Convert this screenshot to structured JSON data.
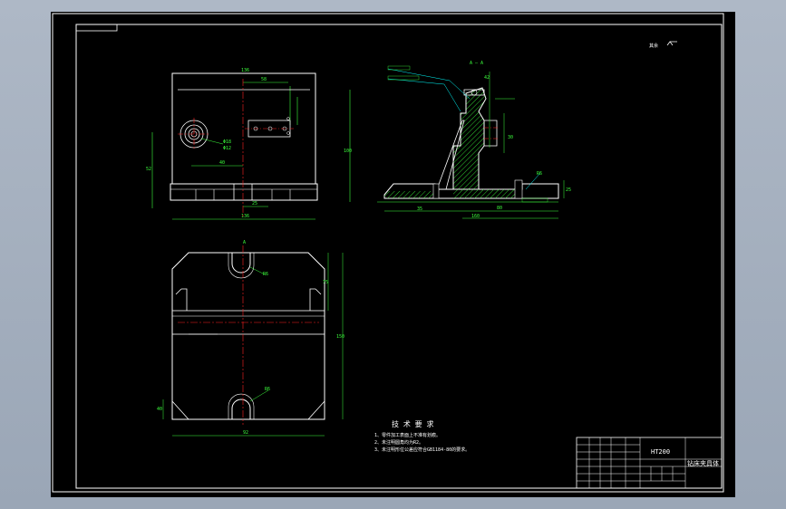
{
  "drawing": {
    "section_label": "A — A",
    "view_label": "A",
    "roughness_note": "其余",
    "tech_requirements": {
      "title": "技 术 要 求",
      "items": [
        "1、零件加工表面上不准有划痕。",
        "2、未注明圆角均为R2。",
        "3、未注明形位公差应符合GB1184-80的要求。"
      ]
    },
    "title_block": {
      "part_number": "HT200",
      "drawing_name": "钻床夹具体"
    },
    "colors": {
      "background": "#000000",
      "outline": "#ffffff",
      "dimension": "#3cff3c",
      "centerline": "#ff2020",
      "hatch": "#3cff3c",
      "leader": "#00ffff"
    }
  }
}
